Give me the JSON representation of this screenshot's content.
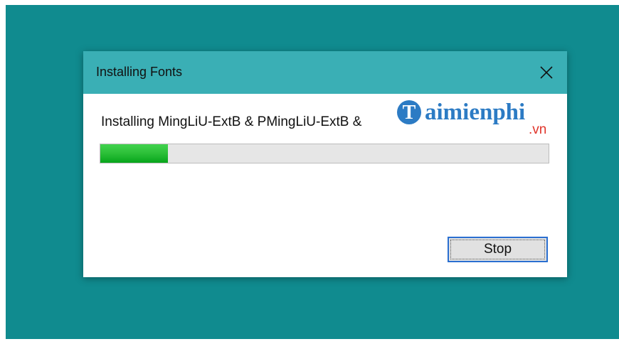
{
  "dialog": {
    "title": "Installing Fonts",
    "close_icon": "close-icon",
    "status_text": "Installing MingLiU-ExtB & PMingLiU-ExtB &",
    "progress_fraction": 0.15,
    "stop_label": "Stop"
  },
  "watermark": {
    "brand": "aimienphi",
    "initial": "T",
    "suffix": ".vn"
  },
  "colors": {
    "desktop": "#108b8f",
    "titlebar": "#3aafb5",
    "progress": "#2ec13a",
    "button_border": "#2a6fd0"
  }
}
